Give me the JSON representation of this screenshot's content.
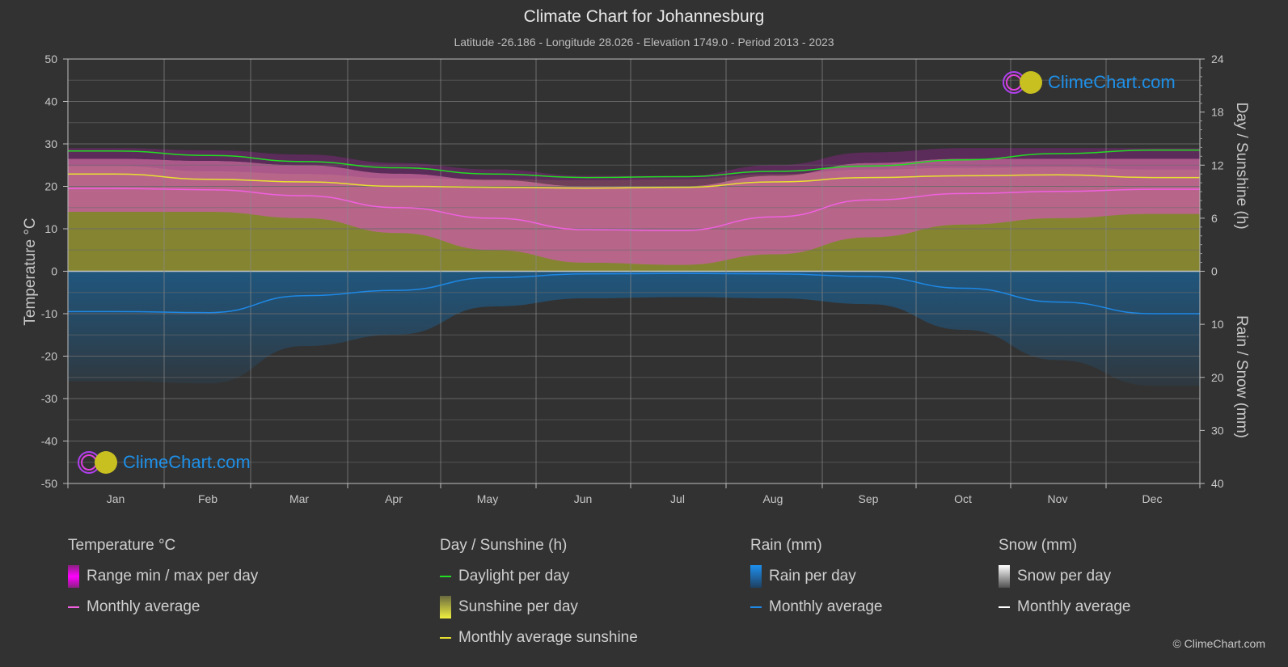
{
  "header": {
    "title": "Climate Chart for Johannesburg",
    "subtitle": "Latitude -26.186 - Longitude 28.026 - Elevation 1749.0 - Period 2013 - 2023"
  },
  "logo": {
    "text": "ClimeChart.com"
  },
  "copyright": "© ClimeChart.com",
  "colors": {
    "background": "#323232",
    "temp_avg": "#f060e0",
    "temp_range": "#d020c0",
    "daylight": "#22dd22",
    "sunshine_avg": "#e8e030",
    "sunshine_fill": "#8a8a32",
    "rain": "#1e88e5",
    "rain_fill": "#1e5a86",
    "snow": "#ffffff",
    "grid": "#5a5a5a"
  },
  "legend": {
    "temperature": {
      "title": "Temperature °C",
      "range": "Range min / max per day",
      "avg": "Monthly average"
    },
    "sunshine": {
      "title": "Day / Sunshine (h)",
      "daylight": "Daylight per day",
      "sunshine": "Sunshine per day",
      "avg": "Monthly average sunshine"
    },
    "rain": {
      "title": "Rain (mm)",
      "per_day": "Rain per day",
      "avg": "Monthly average"
    },
    "snow": {
      "title": "Snow (mm)",
      "per_day": "Snow per day",
      "avg": "Monthly average"
    }
  },
  "chart_data": {
    "type": "line",
    "title": "Climate Chart for Johannesburg",
    "categories": [
      "Jan",
      "Feb",
      "Mar",
      "Apr",
      "May",
      "Jun",
      "Jul",
      "Aug",
      "Sep",
      "Oct",
      "Nov",
      "Dec"
    ],
    "left_axis": {
      "label": "Temperature °C",
      "range": [
        -50,
        50
      ],
      "ticks": [
        50,
        40,
        30,
        20,
        10,
        0,
        -10,
        -20,
        -30,
        -40,
        -50
      ]
    },
    "right_axis_top": {
      "label": "Day / Sunshine (h)",
      "range": [
        0,
        24
      ],
      "ticks": [
        24,
        18,
        12,
        6,
        0
      ]
    },
    "right_axis_bottom": {
      "label": "Rain / Snow (mm)",
      "range": [
        0,
        40
      ],
      "ticks": [
        0,
        10,
        20,
        30,
        40
      ]
    },
    "grid": true,
    "series": [
      {
        "name": "Temperature monthly average",
        "axis": "temperature",
        "values": [
          19.5,
          19.2,
          17.8,
          15.0,
          12.5,
          9.8,
          9.6,
          12.8,
          16.8,
          18.3,
          18.8,
          19.3
        ]
      },
      {
        "name": "Daylight per day",
        "axis": "hours",
        "values": [
          13.6,
          13.1,
          12.4,
          11.7,
          11.0,
          10.6,
          10.7,
          11.3,
          11.9,
          12.6,
          13.3,
          13.7
        ]
      },
      {
        "name": "Monthly average sunshine",
        "axis": "hours",
        "values": [
          11.0,
          10.4,
          10.1,
          9.6,
          9.5,
          9.4,
          9.5,
          10.1,
          10.6,
          10.8,
          10.9,
          10.6
        ]
      },
      {
        "name": "Rain monthly average",
        "axis": "mm",
        "values": [
          7.6,
          7.8,
          4.6,
          3.6,
          1.2,
          0.5,
          0.4,
          0.5,
          1.0,
          3.2,
          5.8,
          8.0
        ]
      },
      {
        "name": "Temperature daily max (approx)",
        "axis": "temperature",
        "values": [
          26.5,
          26.0,
          25.0,
          23.0,
          21.5,
          20.0,
          20.0,
          22.5,
          25.5,
          26.5,
          26.5,
          26.5
        ]
      },
      {
        "name": "Temperature daily min (approx)",
        "axis": "temperature",
        "values": [
          14.0,
          14.0,
          12.5,
          9.0,
          5.0,
          2.0,
          1.5,
          4.0,
          8.0,
          11.0,
          12.5,
          13.5
        ]
      }
    ]
  }
}
